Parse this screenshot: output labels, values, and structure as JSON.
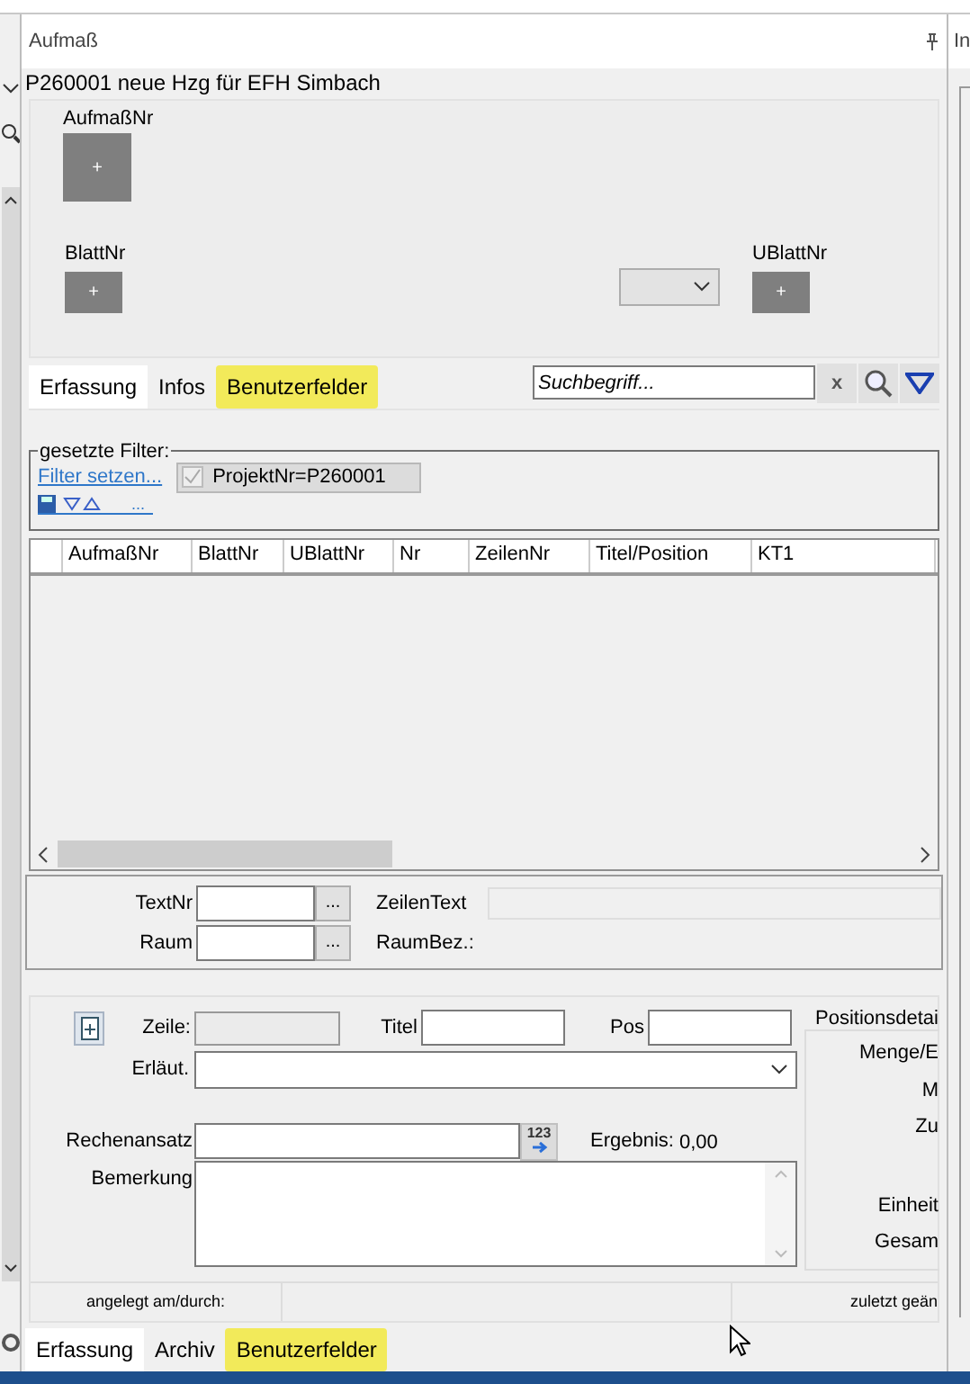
{
  "panel": {
    "title": "Aufmaß"
  },
  "right_panel": {
    "title": "In"
  },
  "project_title": "P260001 neue Hzg für EFH Simbach",
  "header_fields": [
    {
      "label": "AufmaßNr",
      "button": "+"
    },
    {
      "label": "BlattNr",
      "button": "+"
    },
    {
      "label": "UBlattNr",
      "button": "+"
    }
  ],
  "top_tabs": [
    {
      "label": "Erfassung",
      "selected": true,
      "highlighted": false
    },
    {
      "label": "Infos",
      "selected": false,
      "highlighted": false
    },
    {
      "label": "Benutzerfelder",
      "selected": false,
      "highlighted": true
    }
  ],
  "search": {
    "placeholder": "Suchbegriff...",
    "clear": "x"
  },
  "filter": {
    "legend": "gesetzte Filter:",
    "link": "Filter setzen...",
    "chip": {
      "label": "ProjektNr=P260001",
      "checked": true
    },
    "more": "..."
  },
  "table": {
    "columns": [
      "AufmaßNr",
      "BlattNr",
      "UBlattNr",
      "Nr",
      "ZeilenNr",
      "Titel/Position",
      "KT1"
    ]
  },
  "text_fields": {
    "textnr": "TextNr",
    "raum": "Raum",
    "browse": "...",
    "zeilentext": "ZeilenText",
    "raumbez": "RaumBez.:"
  },
  "detail": {
    "zeile": "Zeile:",
    "titel": "Titel",
    "pos": "Pos",
    "erlaeut": "Erläut.",
    "rechenansatz": "Rechenansatz",
    "calc": "123",
    "ergebnis_label": "Ergebnis:",
    "ergebnis_value": "0,00",
    "bemerkung": "Bemerkung"
  },
  "positions_detail": {
    "title": "Positionsdetai",
    "labels": [
      "Menge/E",
      "M",
      "Zu",
      "Einheit",
      "Gesam"
    ]
  },
  "status": {
    "created": "angelegt am/durch:",
    "modified": "zuletzt geän"
  },
  "bottom_tabs": [
    {
      "label": "Erfassung",
      "selected": true,
      "highlighted": false
    },
    {
      "label": "Archiv",
      "selected": false,
      "highlighted": false
    },
    {
      "label": "Benutzerfelder",
      "selected": false,
      "highlighted": true
    }
  ]
}
